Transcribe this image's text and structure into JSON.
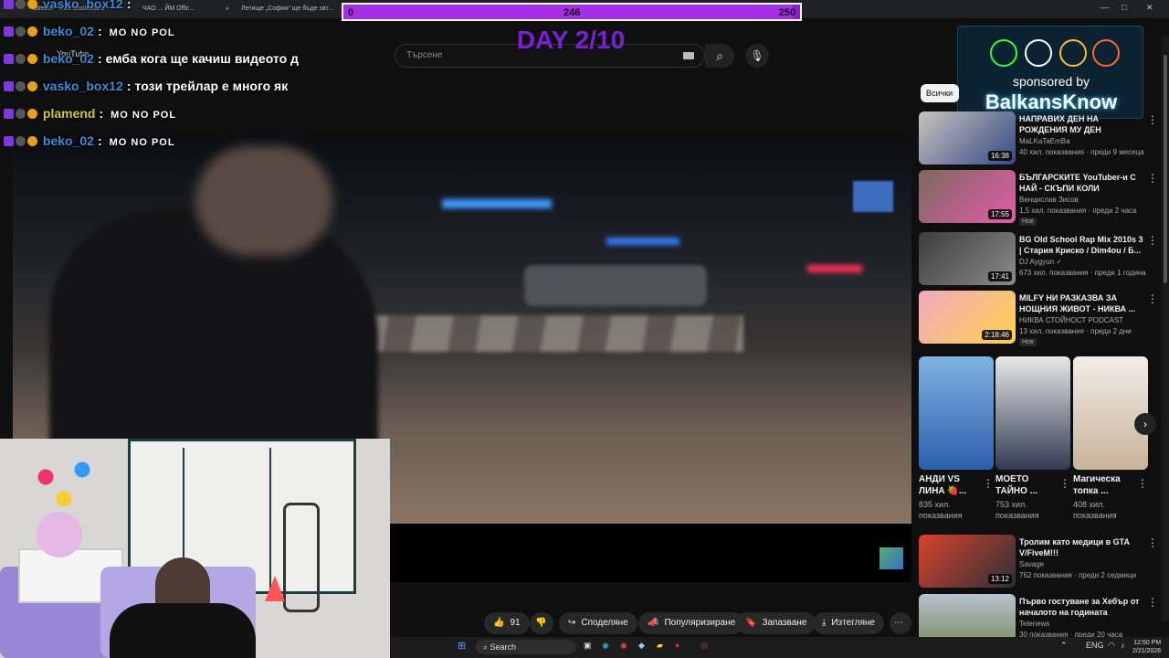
{
  "browser": {
    "tabs": [
      {
        "label": "Stream - Kick Dashboard"
      },
      {
        "label": "ЧАО ... ЙМ Offic..."
      },
      {
        "label": "Летище „София“ ще бъде зат..."
      }
    ],
    "window_controls": [
      "—",
      "□",
      "✕"
    ]
  },
  "overlay": {
    "goal": {
      "start": "0",
      "current": "246",
      "target": "250",
      "progress_fraction": 0.984
    },
    "day": "DAY 2/10",
    "sponsor_by": "sponsored by",
    "sponsor_name": "BalkansKnow"
  },
  "header": {
    "logo_text": "YouTube",
    "search_placeholder": "Търсене"
  },
  "chat": [
    {
      "user": "vasko_box12",
      "sep": ":",
      "message": "",
      "emotes": "",
      "color": "#3f8ad9"
    },
    {
      "user": "beko_02",
      "sep": ":",
      "message": "",
      "emotes": "MO NO POL",
      "color": "#3f8ad9"
    },
    {
      "user": "beko_02",
      "sep": ":",
      "message": "емба кога ще качиш видеото д",
      "emotes": "",
      "color": "#3f8ad9"
    },
    {
      "user": "vasko_box12",
      "sep": ":",
      "message": "този трейлар е много як",
      "emotes": "",
      "color": "#3f8ad9"
    },
    {
      "user": "plamend",
      "sep": ":",
      "message": "",
      "emotes": "MO NO POL",
      "color": "#d4c63a"
    },
    {
      "user": "beko_02",
      "sep": ":",
      "message": "",
      "emotes": "MO NO POL",
      "color": "#3f8ad9"
    }
  ],
  "sidebar": {
    "chip": "Всички",
    "recommendations": [
      {
        "title": "НАПРАВИХ ДЕН НА РОЖДЕНИЯ МУ ДЕН",
        "channel": "MaLKaTaEmBa",
        "meta": "40 хил. показвания · преди 9 месеца",
        "duration": "16:38",
        "new": ""
      },
      {
        "title": "БЪЛГАРСКИТЕ YouTuber-и С НАЙ - СКЪПИ КОЛИ",
        "channel": "Венцислав Зисов",
        "meta": "1,5 хил. показвания · преди 2 часа",
        "duration": "17:55",
        "new": "Нов"
      },
      {
        "title": "BG Old School Rap Mix 2010s 3 | Стария Криско / Dim4ou / Б...",
        "channel": "DJ Aygyun ✓",
        "meta": "673 хил. показвания · преди 1 година",
        "duration": "17:41",
        "new": ""
      },
      {
        "title": "MILFY НИ РАЗКАЗВА ЗА НОЩНИЯ ЖИВОТ - НИКВА ...",
        "channel": "НИКВА СТОЙНОСТ PODCAST",
        "meta": "13 хил. показвания · преди 2 дни",
        "duration": "2:18:46",
        "new": "Нов"
      },
      {
        "title": "Тролим като медици в GTA V/FiveM!!!",
        "channel": "Savage",
        "meta": "762 показвания · преди 2 седмици",
        "duration": "13:12",
        "new": ""
      },
      {
        "title": "Първо гостуване за Хебър от началото на годината",
        "channel": "Telenews",
        "meta": "30 показвания · преди 20 часа",
        "duration": "",
        "new": ""
      }
    ],
    "shorts": [
      {
        "title": "АНДИ VS ЛИНА 🍓...",
        "views": "835 хил. показвания"
      },
      {
        "title": "МОЕТО ТАЙНО ...",
        "views": "753 хил. показвания"
      },
      {
        "title": "Магическа топка ...",
        "views": "408 хил. показвания"
      }
    ]
  },
  "actions": {
    "likes": "91",
    "share": "Споделяне",
    "promote": "Популяризиране",
    "save": "Запазване",
    "download": "Изтегляне",
    "more": "⋯"
  },
  "taskbar": {
    "search": "Search",
    "lang": "ENG",
    "time": "12:50 PM",
    "date": "2/21/2026"
  }
}
